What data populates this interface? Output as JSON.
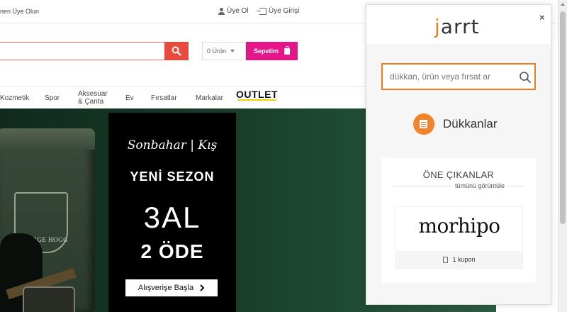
{
  "top_bar": {
    "promo_text": "nen Üye Olun",
    "register_label": "Üye Ol",
    "login_label": "Üye Girişi"
  },
  "header": {
    "search_value": "",
    "cart_count": "0 Ürün",
    "cart_button_label": "Sepetim"
  },
  "nav": {
    "items": [
      "Kozmetik",
      "Spor",
      "Aksesuar",
      "& Çanta",
      "Ev",
      "Fırsatlar",
      "Markalar",
      "OUTLET"
    ]
  },
  "hero": {
    "product_brand": "GEORGE HOGG",
    "promo_line1": "Sonbahar | Kış",
    "promo_line2": "YENİ SEZON",
    "promo_line3": "3AL",
    "promo_line4": "2 ÖDE",
    "cta_label": "Alışverişe Başla"
  },
  "popup": {
    "logo_text": "arrt",
    "logo_letter": "j",
    "close_label": "×",
    "search_placeholder": "dükkan, ürün veya fırsat ar",
    "shops_label": "Dükkanlar",
    "featured_title": "ÖNE ÇIKANLAR",
    "view_all_label": "tümünü görüntüle",
    "featured_brand": "morhipo",
    "coupon_text": "1 kupon"
  },
  "colors": {
    "accent_orange": "#f07c1b",
    "cart_pink": "#e5168a",
    "search_red": "#e84b3c"
  }
}
